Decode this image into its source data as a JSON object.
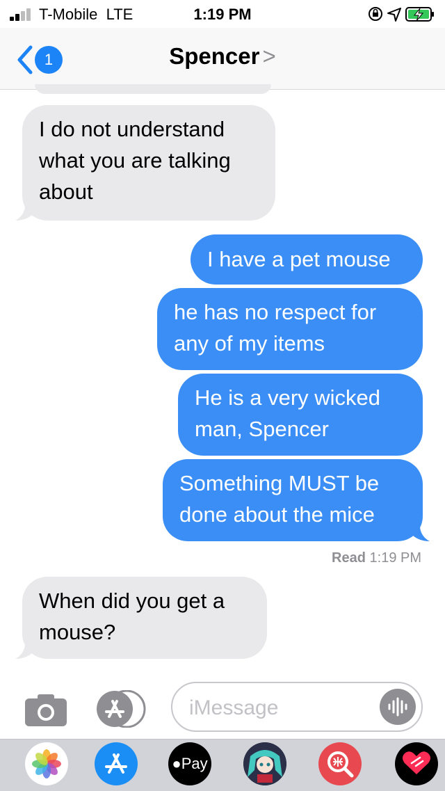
{
  "status_bar": {
    "carrier": "T-Mobile",
    "network": "LTE",
    "time": "1:19 PM",
    "icons": [
      "signal-icon",
      "orientation-lock-icon",
      "location-icon",
      "battery-charging-icon"
    ],
    "battery_color": "#34c759"
  },
  "nav": {
    "back_badge": "1",
    "contact_name": "Spencer",
    "chevron": ">",
    "accent": "#1d84f7"
  },
  "messages": [
    {
      "direction": "received",
      "text_lines": [
        "I do not understand",
        "what you are talking",
        "about"
      ]
    },
    {
      "direction": "sent",
      "text_lines": [
        "I have a pet mouse"
      ]
    },
    {
      "direction": "sent",
      "text_lines": [
        "he has no respect for",
        "any of my items"
      ]
    },
    {
      "direction": "sent",
      "text_lines": [
        "He is a very wicked",
        "man, Spencer"
      ]
    },
    {
      "direction": "sent",
      "text_lines": [
        "Something MUST be",
        "done about the mice"
      ]
    },
    {
      "direction": "received",
      "text_lines": [
        "When did you get a",
        "mouse?"
      ]
    }
  ],
  "read_receipt": {
    "label": "Read",
    "time": "1:19 PM"
  },
  "compose": {
    "placeholder": "iMessage"
  },
  "app_drawer": {
    "apps": [
      {
        "icon": "photos-icon"
      },
      {
        "icon": "app-store-icon"
      },
      {
        "icon": "apple-pay-icon",
        "label": "Pay"
      },
      {
        "icon": "sticker-app-icon"
      },
      {
        "icon": "search-images-icon"
      },
      {
        "icon": "digital-touch-icon"
      }
    ]
  },
  "colors": {
    "sent_bubble": "#3b8ef5",
    "received_bubble": "#e9e9eb",
    "drawer_bg": "#d1d3d9"
  }
}
